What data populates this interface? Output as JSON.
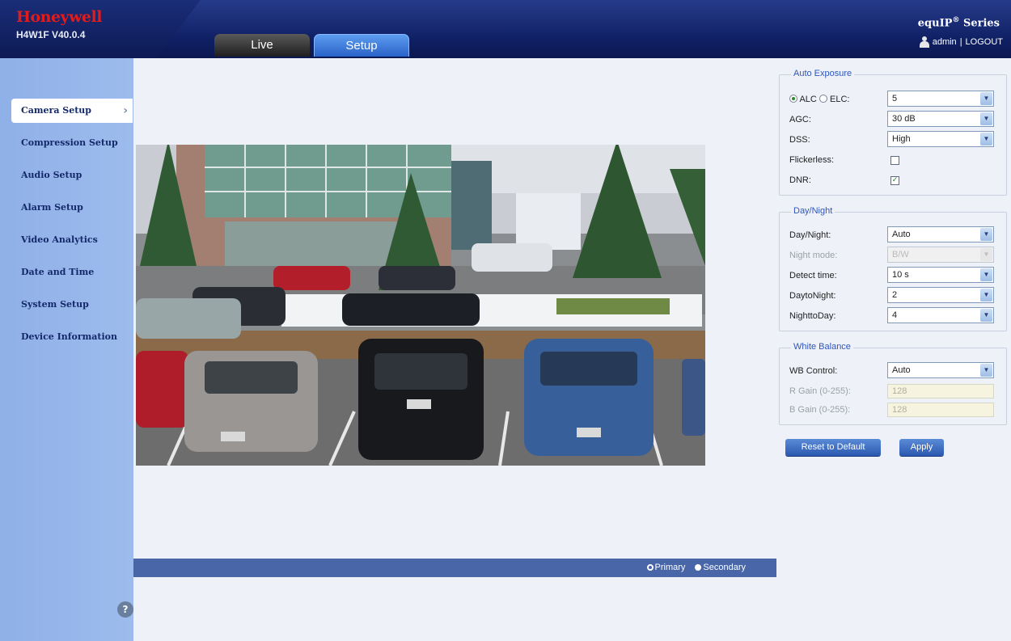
{
  "header": {
    "brand": "Honeywell",
    "model": "H4W1F  V40.0.4",
    "product_title": "equIP",
    "product_mark": "®",
    "product_suffix": " Series",
    "user": "admin",
    "separator": "|",
    "logout": "LOGOUT",
    "tabs": [
      {
        "label": "Live",
        "active": false
      },
      {
        "label": "Setup",
        "active": true
      }
    ]
  },
  "sidebar": {
    "items": [
      {
        "label": "Camera Setup",
        "active": true
      },
      {
        "label": "Compression Setup",
        "active": false
      },
      {
        "label": "Audio Setup",
        "active": false
      },
      {
        "label": "Alarm Setup",
        "active": false
      },
      {
        "label": "Video Analytics",
        "active": false
      },
      {
        "label": "Date and Time",
        "active": false
      },
      {
        "label": "System Setup",
        "active": false
      },
      {
        "label": "Device Information",
        "active": false
      }
    ],
    "help_icon": "?"
  },
  "stream": {
    "primary": "Primary",
    "secondary": "Secondary",
    "selected": "Primary"
  },
  "auto_exposure": {
    "legend": "Auto Exposure",
    "alc_label": "ALC",
    "elc_label": "ELC:",
    "mode_selected": "ALC",
    "level_value": "5",
    "agc_label": "AGC:",
    "agc_value": "30 dB",
    "dss_label": "DSS:",
    "dss_value": "High",
    "flickerless_label": "Flickerless:",
    "flickerless_checked": false,
    "dnr_label": "DNR:",
    "dnr_checked": true
  },
  "day_night": {
    "legend": "Day/Night",
    "day_night_label": "Day/Night:",
    "day_night_value": "Auto",
    "night_mode_label": "Night mode:",
    "night_mode_value": "B/W",
    "detect_time_label": "Detect time:",
    "detect_time_value": "10 s",
    "day_to_night_label": "DaytoNight:",
    "day_to_night_value": "2",
    "night_to_day_label": "NighttoDay:",
    "night_to_day_value": "4"
  },
  "white_balance": {
    "legend": "White Balance",
    "wb_control_label": "WB Control:",
    "wb_control_value": "Auto",
    "r_gain_label": "R Gain (0-255):",
    "r_gain_value": "128",
    "b_gain_label": "B Gain (0-255):",
    "b_gain_value": "128"
  },
  "actions": {
    "reset": "Reset to Default",
    "apply": "Apply"
  },
  "colors": {
    "header_bg": "#13236b",
    "sidebar_bg": "#96b6ea",
    "accent": "#2f56ba",
    "brand_red": "#e21b1b"
  }
}
